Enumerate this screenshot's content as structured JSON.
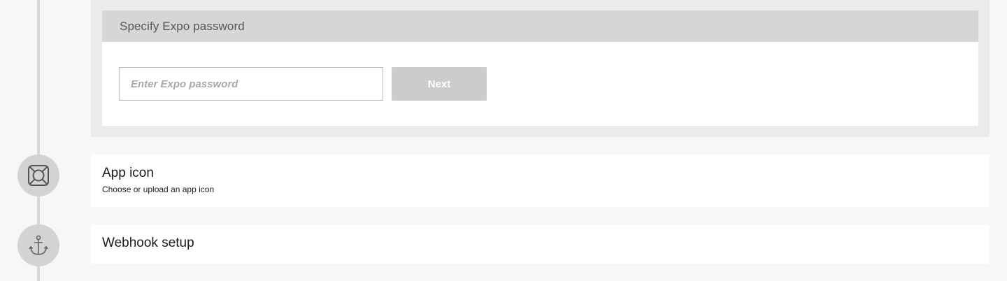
{
  "password_step": {
    "header_title": "Specify Expo password",
    "input_placeholder": "Enter Expo password",
    "input_value": "",
    "next_label": "Next"
  },
  "steps": [
    {
      "icon": "app-icon-square-icon",
      "title": "App icon",
      "subtitle": "Choose or upload an app icon"
    },
    {
      "icon": "anchor-icon",
      "title": "Webhook setup"
    }
  ],
  "colors": {
    "page_bg": "#f7f7f7",
    "panel_bg": "#ebebeb",
    "header_bg": "#d6d6d6",
    "button_disabled": "#cccccc",
    "badge_bg": "#d3d3d3"
  }
}
